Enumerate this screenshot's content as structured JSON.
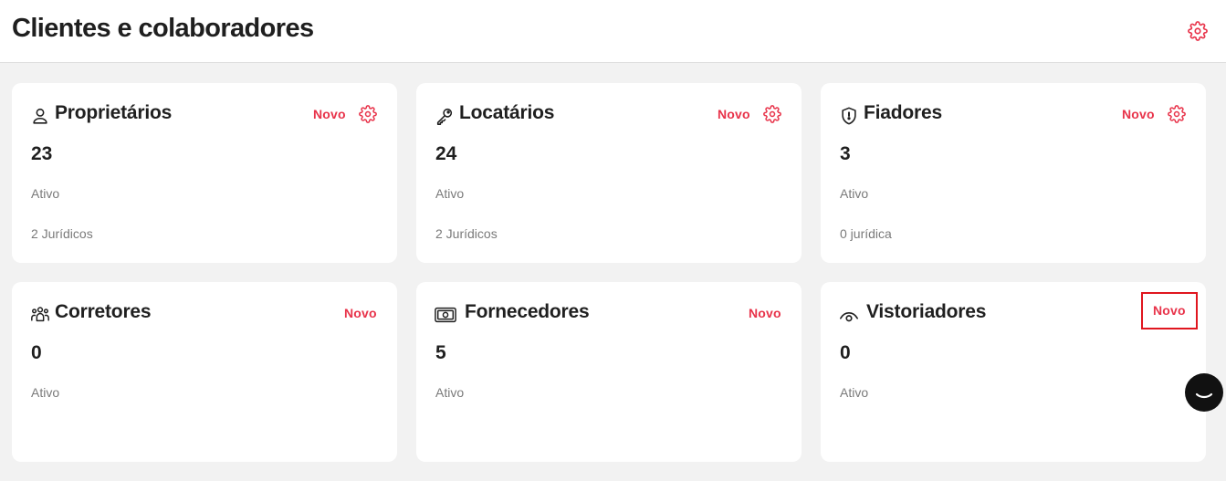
{
  "header": {
    "title": "Clientes e colaboradores",
    "settings_icon": "gear-icon"
  },
  "colors": {
    "accent": "#e8334a",
    "highlight_border": "#e0161f",
    "background": "#f2f2f2",
    "card": "#ffffff",
    "text": "#1f1f1f",
    "muted": "#7a7a7a"
  },
  "cards": [
    {
      "title": "Proprietários",
      "icon": "user-icon",
      "new_label": "Novo",
      "has_settings": true,
      "count": "23",
      "status": "Ativo",
      "legal_entities": "2 Jurídicos"
    },
    {
      "title": "Locatários",
      "icon": "key-icon",
      "new_label": "Novo",
      "has_settings": true,
      "count": "24",
      "status": "Ativo",
      "legal_entities": "2 Jurídicos"
    },
    {
      "title": "Fiadores",
      "icon": "shield-icon",
      "new_label": "Novo",
      "has_settings": true,
      "count": "3",
      "status": "Ativo",
      "legal_entities": "0 jurídica"
    },
    {
      "title": "Corretores",
      "icon": "users-group-icon",
      "new_label": "Novo",
      "has_settings": false,
      "count": "0",
      "status": "Ativo"
    },
    {
      "title": "Fornecedores",
      "icon": "money-icon",
      "new_label": "Novo",
      "has_settings": false,
      "count": "5",
      "status": "Ativo"
    },
    {
      "title": "Vistoriadores",
      "icon": "eye-icon",
      "new_label": "Novo",
      "has_settings": false,
      "count": "0",
      "status": "Ativo"
    }
  ],
  "chat_widget": {
    "icon": "chat-icon"
  }
}
